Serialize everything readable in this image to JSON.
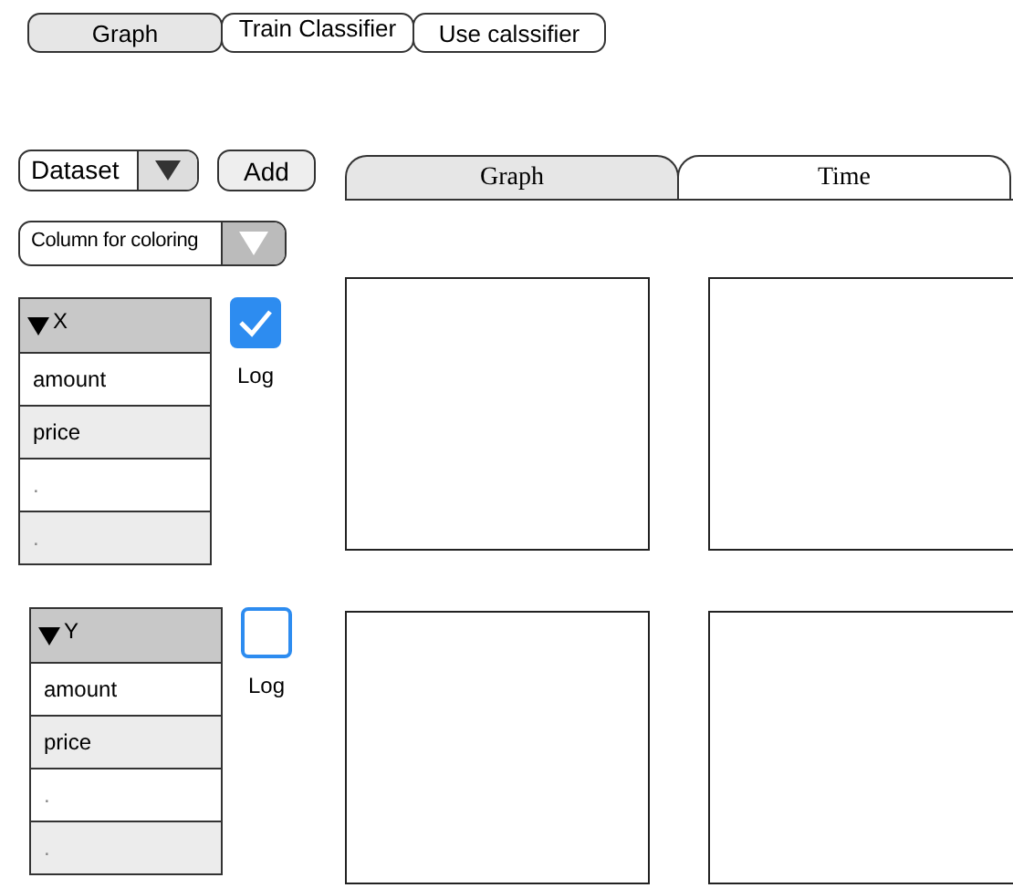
{
  "top_tabs": [
    {
      "label": "Graph",
      "selected": true
    },
    {
      "label": "Train Classifier",
      "selected": false
    },
    {
      "label": "Use calssifier",
      "selected": false
    }
  ],
  "dataset_dropdown": {
    "value": "Dataset"
  },
  "add_button": "Add",
  "color_dropdown": {
    "value": "Column for coloring"
  },
  "axes": [
    {
      "header": "X",
      "items": [
        "amount",
        "price",
        ".",
        "."
      ],
      "log_label": "Log",
      "log_checked": true
    },
    {
      "header": "Y",
      "items": [
        "amount",
        "price",
        ".",
        "."
      ],
      "log_label": "Log",
      "log_checked": false
    }
  ],
  "view_tabs": [
    {
      "label": "Graph",
      "selected": true
    },
    {
      "label": "Time",
      "selected": false
    }
  ]
}
